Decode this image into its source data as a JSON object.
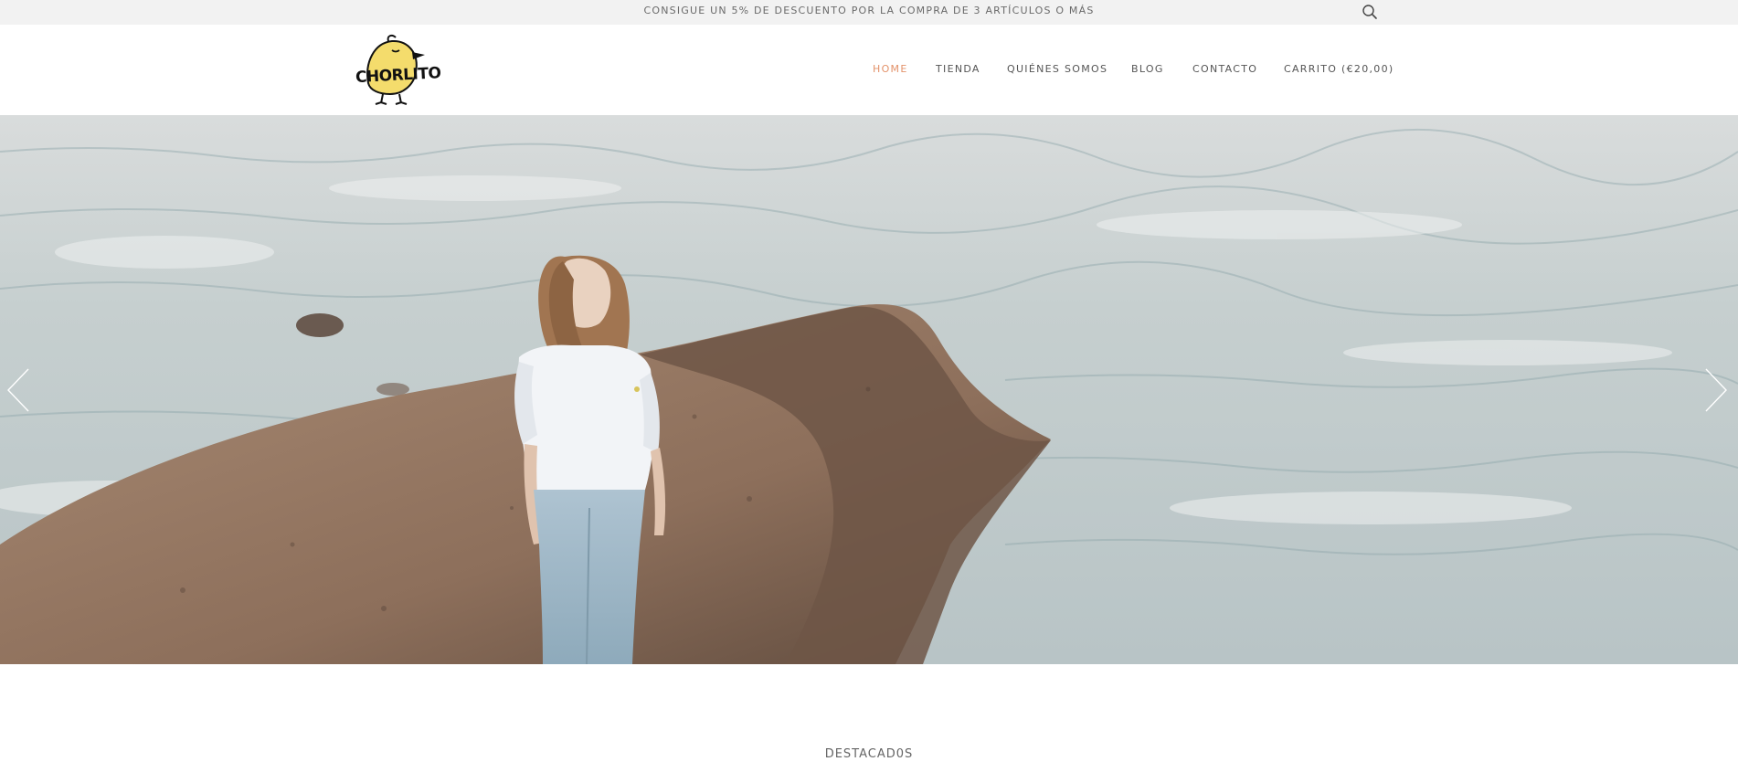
{
  "announcement": {
    "text": "CONSIGUE UN 5% DE DESCUENTO POR LA COMPRA DE 3 ARTÍCULOS O MÁS",
    "search_icon": "search-icon"
  },
  "header": {
    "logo_text": "CHORLITO",
    "nav": [
      {
        "label": "HOME",
        "active": true
      },
      {
        "label": "TIENDA",
        "active": false
      },
      {
        "label": "QUIÉNES SOMOS",
        "active": false
      },
      {
        "label": "BLOG",
        "active": false
      },
      {
        "label": "CONTACTO",
        "active": false
      },
      {
        "label": "CARRITO (€20,00)",
        "active": false
      }
    ]
  },
  "hero": {
    "prev_icon": "chevron-left-icon",
    "next_icon": "chevron-right-icon"
  },
  "featured": {
    "title": "DESTACAD0S"
  },
  "colors": {
    "accent": "#e3926a",
    "announcement_bg": "#f2f2f2",
    "nav_text": "#555555",
    "logo_yellow": "#f4dc6c"
  }
}
